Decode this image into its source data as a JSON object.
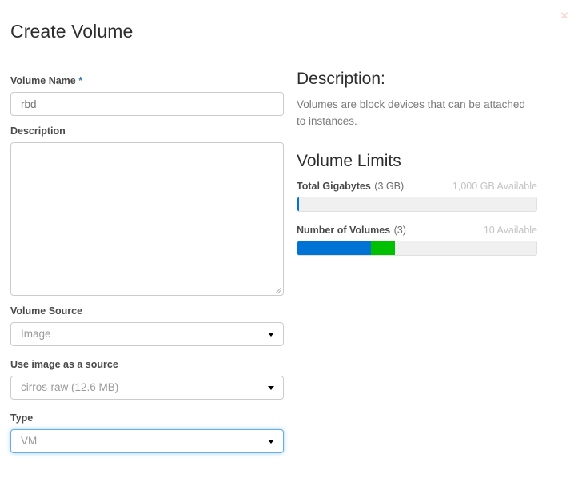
{
  "modal": {
    "title": "Create Volume",
    "close_label": "×"
  },
  "form": {
    "volume_name": {
      "label": "Volume Name",
      "required_marker": "*",
      "value": "rbd",
      "placeholder": "rbd"
    },
    "description": {
      "label": "Description",
      "value": "",
      "placeholder": ""
    },
    "volume_source": {
      "label": "Volume Source",
      "selected": "Image",
      "options": [
        "Image"
      ]
    },
    "image_source": {
      "label": "Use image as a source",
      "selected": "cirros-raw (12.6 MB)",
      "options": [
        "cirros-raw (12.6 MB)"
      ]
    },
    "type": {
      "label": "Type",
      "selected": "VM",
      "options": [
        "VM"
      ],
      "focused": true
    }
  },
  "side": {
    "description_heading": "Description:",
    "description_text": "Volumes are block devices that can be attached to instances.",
    "limits_heading": "Volume Limits",
    "limits": [
      {
        "name": "Total Gigabytes",
        "used": "(3 GB)",
        "available": "1,000 GB Available",
        "segments": [
          {
            "color": "#0073d4",
            "percent": 0.7
          }
        ]
      },
      {
        "name": "Number of Volumes",
        "used": "(3)",
        "available": "10 Available",
        "segments": [
          {
            "color": "#0073d4",
            "percent": 30.7
          },
          {
            "color": "#00c000",
            "percent": 10.0
          }
        ]
      }
    ]
  },
  "colors": {
    "accent_blue": "#0073d4",
    "accent_green": "#00c000",
    "required_star": "#337ab7",
    "focus_ring": "#66afe9",
    "close_x": "#f9d9d2"
  }
}
